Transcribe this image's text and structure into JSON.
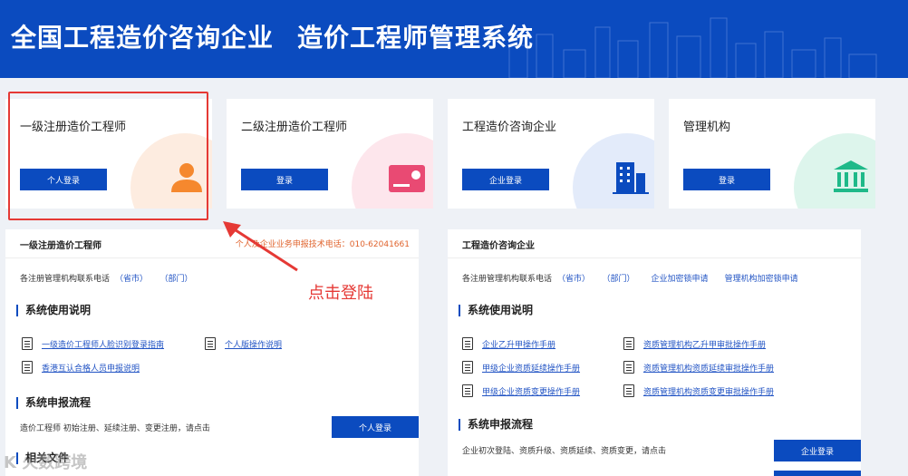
{
  "header": {
    "title_part1": "全国工程造价咨询企业",
    "title_part2": "造价工程师管理系统"
  },
  "cards": [
    {
      "title": "一级注册造价工程师",
      "button": "个人登录",
      "icon": "person-icon",
      "color": "#f5882e"
    },
    {
      "title": "二级注册造价工程师",
      "button": "登录",
      "icon": "id-card-icon",
      "color": "#e94a73"
    },
    {
      "title": "工程造价咨询企业",
      "button": "企业登录",
      "icon": "building-icon",
      "color": "#0b4bbf"
    },
    {
      "title": "管理机构",
      "button": "登录",
      "icon": "institution-icon",
      "color": "#1fb989"
    }
  ],
  "left_panel": {
    "title": "一级注册造价工程师",
    "phone": "个人及企业业务申报技术电话：010-62041661",
    "contact_label": "各注册管理机构联系电话",
    "contact_links": [
      "（省市）",
      "（部门）"
    ],
    "usage_title": "系统使用说明",
    "docs": [
      "一级造价工程师人脸识别登录指南",
      "个人版操作说明",
      "香港互认合格人员申报说明"
    ],
    "flow_title": "系统申报流程",
    "flow_text": "造价工程师 初始注册、延续注册、变更注册，请点击",
    "flow_button": "个人登录",
    "related_title": "相关文件"
  },
  "right_panel": {
    "title": "工程造价咨询企业",
    "contact_label": "各注册管理机构联系电话",
    "contact_links": [
      "（省市）",
      "（部门）",
      "企业加密锁申请",
      "管理机构加密锁申请"
    ],
    "usage_title": "系统使用说明",
    "docs_col1": [
      "企业乙升甲操作手册",
      "甲级企业资质延续操作手册",
      "甲级企业资质变更操作手册"
    ],
    "docs_col2": [
      "资质管理机构乙升甲审批操作手册",
      "资质管理机构资质延续审批操作手册",
      "资质管理机构资质变更审批操作手册"
    ],
    "flow_title": "系统申报流程",
    "flow_text": "企业初次登陆、资质升级、资质延续、资质变更，请点击",
    "flow_button": "企业登录"
  },
  "annotation": {
    "text": "点击登陆",
    "color": "#e53935"
  },
  "watermark": "K  火数跨境",
  "colors": {
    "brand": "#0b4bbf",
    "link": "#2254c4",
    "phone": "#e0642e"
  }
}
